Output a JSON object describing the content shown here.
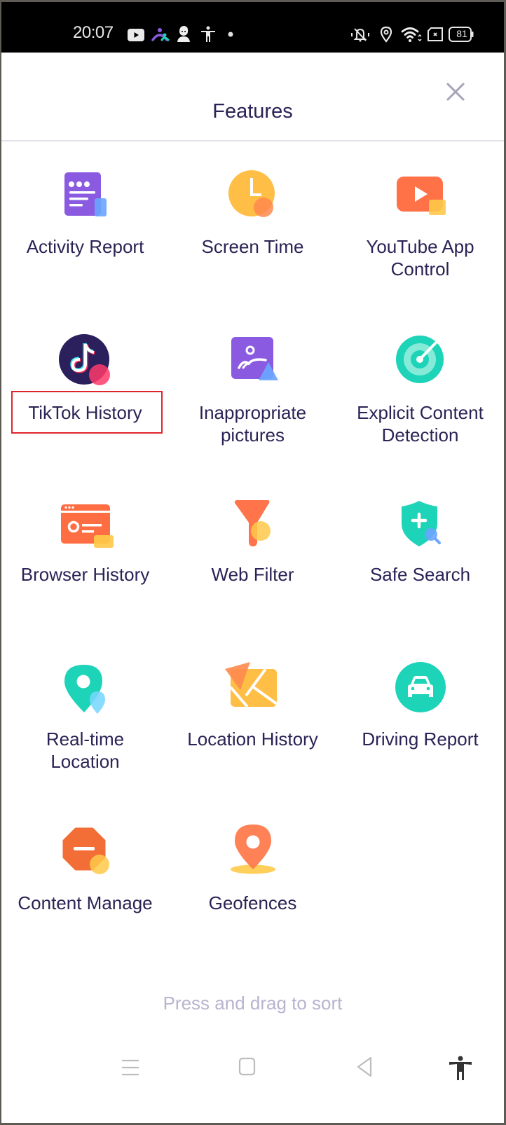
{
  "status_bar": {
    "time": "20:07",
    "left_icons": [
      "youtube-icon",
      "family-app-icon",
      "avatar-app-icon",
      "accessibility-icon",
      "notification-dot-icon"
    ],
    "right_icons": [
      "vibrate-mute-icon",
      "location-icon",
      "wifi-icon",
      "screen-record-icon",
      "battery-icon"
    ],
    "battery_level": "81"
  },
  "header": {
    "title": "Features",
    "close_icon": "close-icon"
  },
  "features": [
    {
      "label": "Activity Report",
      "icon": "activity-report-icon"
    },
    {
      "label": "Screen Time",
      "icon": "clock-icon"
    },
    {
      "label": "YouTube App Control",
      "label_lines": [
        "YouTube App",
        "Control"
      ],
      "icon": "youtube-play-icon"
    },
    {
      "label": "TikTok History",
      "icon": "tiktok-icon",
      "highlighted": true
    },
    {
      "label": "Inappropriate pictures",
      "label_lines": [
        "Inappropriate",
        "pictures"
      ],
      "icon": "picture-icon"
    },
    {
      "label": "Explicit Content Detection",
      "label_lines": [
        "Explicit Content",
        "Detection"
      ],
      "icon": "target-icon"
    },
    {
      "label": "Browser History",
      "icon": "browser-icon"
    },
    {
      "label": "Web Filter",
      "icon": "funnel-icon"
    },
    {
      "label": "Safe Search",
      "icon": "shield-search-icon"
    },
    {
      "label": "Real-time Location",
      "label_lines": [
        "Real-time",
        "Location"
      ],
      "icon": "map-pin-icon"
    },
    {
      "label": "Location History",
      "icon": "map-icon"
    },
    {
      "label": "Driving Report",
      "icon": "car-icon"
    },
    {
      "label": "Content Manage",
      "icon": "stop-sign-icon"
    },
    {
      "label": "Geofences",
      "icon": "geofence-pin-icon"
    }
  ],
  "hint": "Press and drag to sort",
  "nav_bar": {
    "buttons": [
      "menu-icon",
      "home-icon",
      "back-icon",
      "accessibility-icon"
    ]
  },
  "colors": {
    "title_text": "#2a2355",
    "hint_text": "#b9b3cf",
    "highlight_border": "#e0242a",
    "purple": "#8a5be0",
    "orange": "#ff7a4d",
    "yellow": "#ffc04a",
    "teal": "#1dd3b8",
    "blue": "#6aa5ff"
  }
}
